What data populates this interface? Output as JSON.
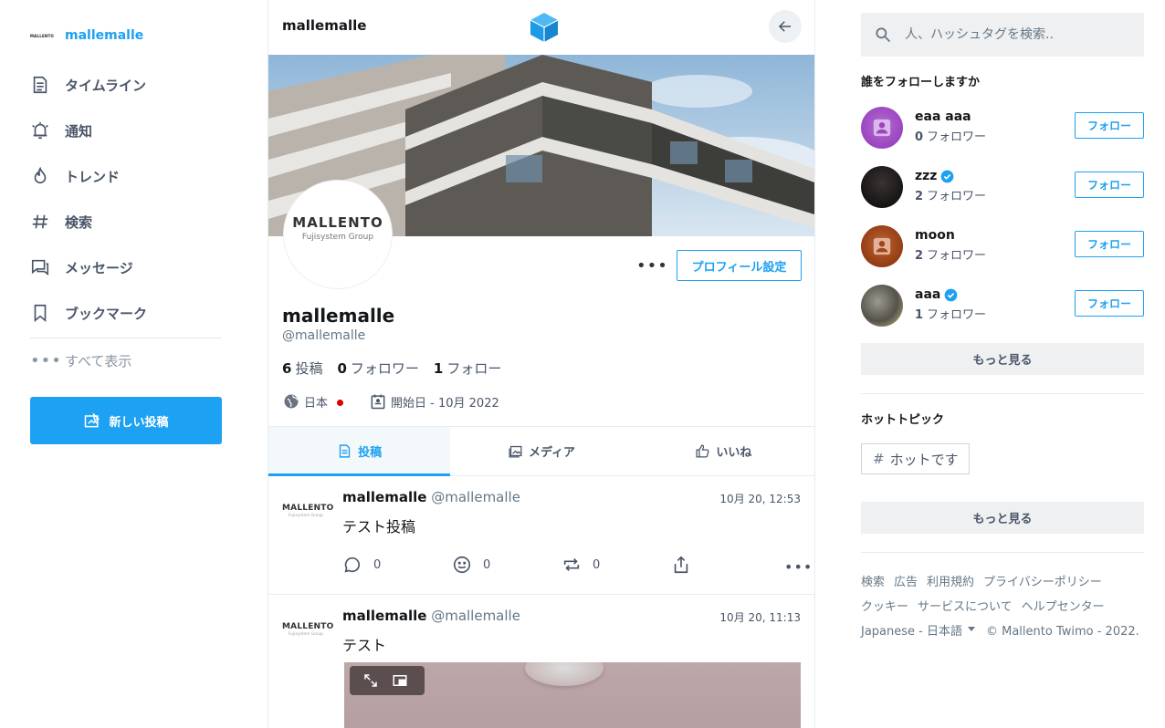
{
  "sidebar": {
    "brand_logo_text": "MALLENTO",
    "brand_name": "mallemalle",
    "items": [
      {
        "label": "タイムライン",
        "icon": "document-icon"
      },
      {
        "label": "通知",
        "icon": "bell-icon"
      },
      {
        "label": "トレンド",
        "icon": "flame-icon"
      },
      {
        "label": "検索",
        "icon": "hash-icon"
      },
      {
        "label": "メッセージ",
        "icon": "message-icon"
      },
      {
        "label": "ブックマーク",
        "icon": "bookmark-icon"
      }
    ],
    "show_all_label": "すべて表示",
    "new_post_label": "新しい投稿"
  },
  "header": {
    "title": "mallemalle"
  },
  "profile": {
    "avatar_text": "MALLENTO",
    "avatar_subtext": "Fujisystem Group",
    "settings_label": "プロフィール設定",
    "name": "mallemalle",
    "handle": "@mallemalle",
    "posts_count": "6",
    "posts_label": "投稿",
    "followers_count": "0",
    "followers_label": "フォロワー",
    "following_count": "1",
    "following_label": "フォロー",
    "location": "日本",
    "joined": "開始日 - 10月 2022"
  },
  "tabs": [
    {
      "label": "投稿",
      "active": true
    },
    {
      "label": "メディア",
      "active": false
    },
    {
      "label": "いいね",
      "active": false
    }
  ],
  "posts": [
    {
      "avatar_text": "MALLENTO",
      "avatar_subtext": "Fujisystem Group",
      "name": "mallemalle",
      "handle": "@mallemalle",
      "time": "10月 20, 12:53",
      "text": "テスト投稿",
      "replies": "0",
      "reactions": "0",
      "reposts": "0"
    },
    {
      "avatar_text": "MALLENTO",
      "avatar_subtext": "Fujisystem Group",
      "name": "mallemalle",
      "handle": "@mallemalle",
      "time": "10月 20, 11:13",
      "text": "テスト"
    }
  ],
  "right": {
    "search_placeholder": "人、ハッシュタグを検索..",
    "who_to_follow_title": "誰をフォローしますか",
    "suggestions": [
      {
        "name": "eaa aaa",
        "count": "0",
        "count_label": "フォロワー",
        "verified": false,
        "follow_label": "フォロー",
        "avatar_color": "#a44fc4"
      },
      {
        "name": "zzz",
        "count": "2",
        "count_label": "フォロワー",
        "verified": true,
        "follow_label": "フォロー",
        "avatar_color": "#2a2626"
      },
      {
        "name": "moon",
        "count": "2",
        "count_label": "フォロワー",
        "verified": false,
        "follow_label": "フォロー",
        "avatar_color": "#a0461b"
      },
      {
        "name": "aaa",
        "count": "1",
        "count_label": "フォロワー",
        "verified": true,
        "follow_label": "フォロー",
        "avatar_color": "#6f6a5e"
      }
    ],
    "see_more_label": "もっと見る",
    "hot_topics_title": "ホットトピック",
    "hot_topic": "ホットです",
    "see_more_label_2": "もっと見る",
    "footer_links": [
      "検索",
      "広告",
      "利用規約",
      "プライバシーポリシー",
      "クッキー",
      "サービスについて",
      "ヘルプセンター"
    ],
    "language": "Japanese - 日本語",
    "copyright": "© Mallento Twimo - 2022."
  },
  "colors": {
    "accent": "#1da1f2",
    "text": "#14171a",
    "muted": "#4a5568"
  }
}
